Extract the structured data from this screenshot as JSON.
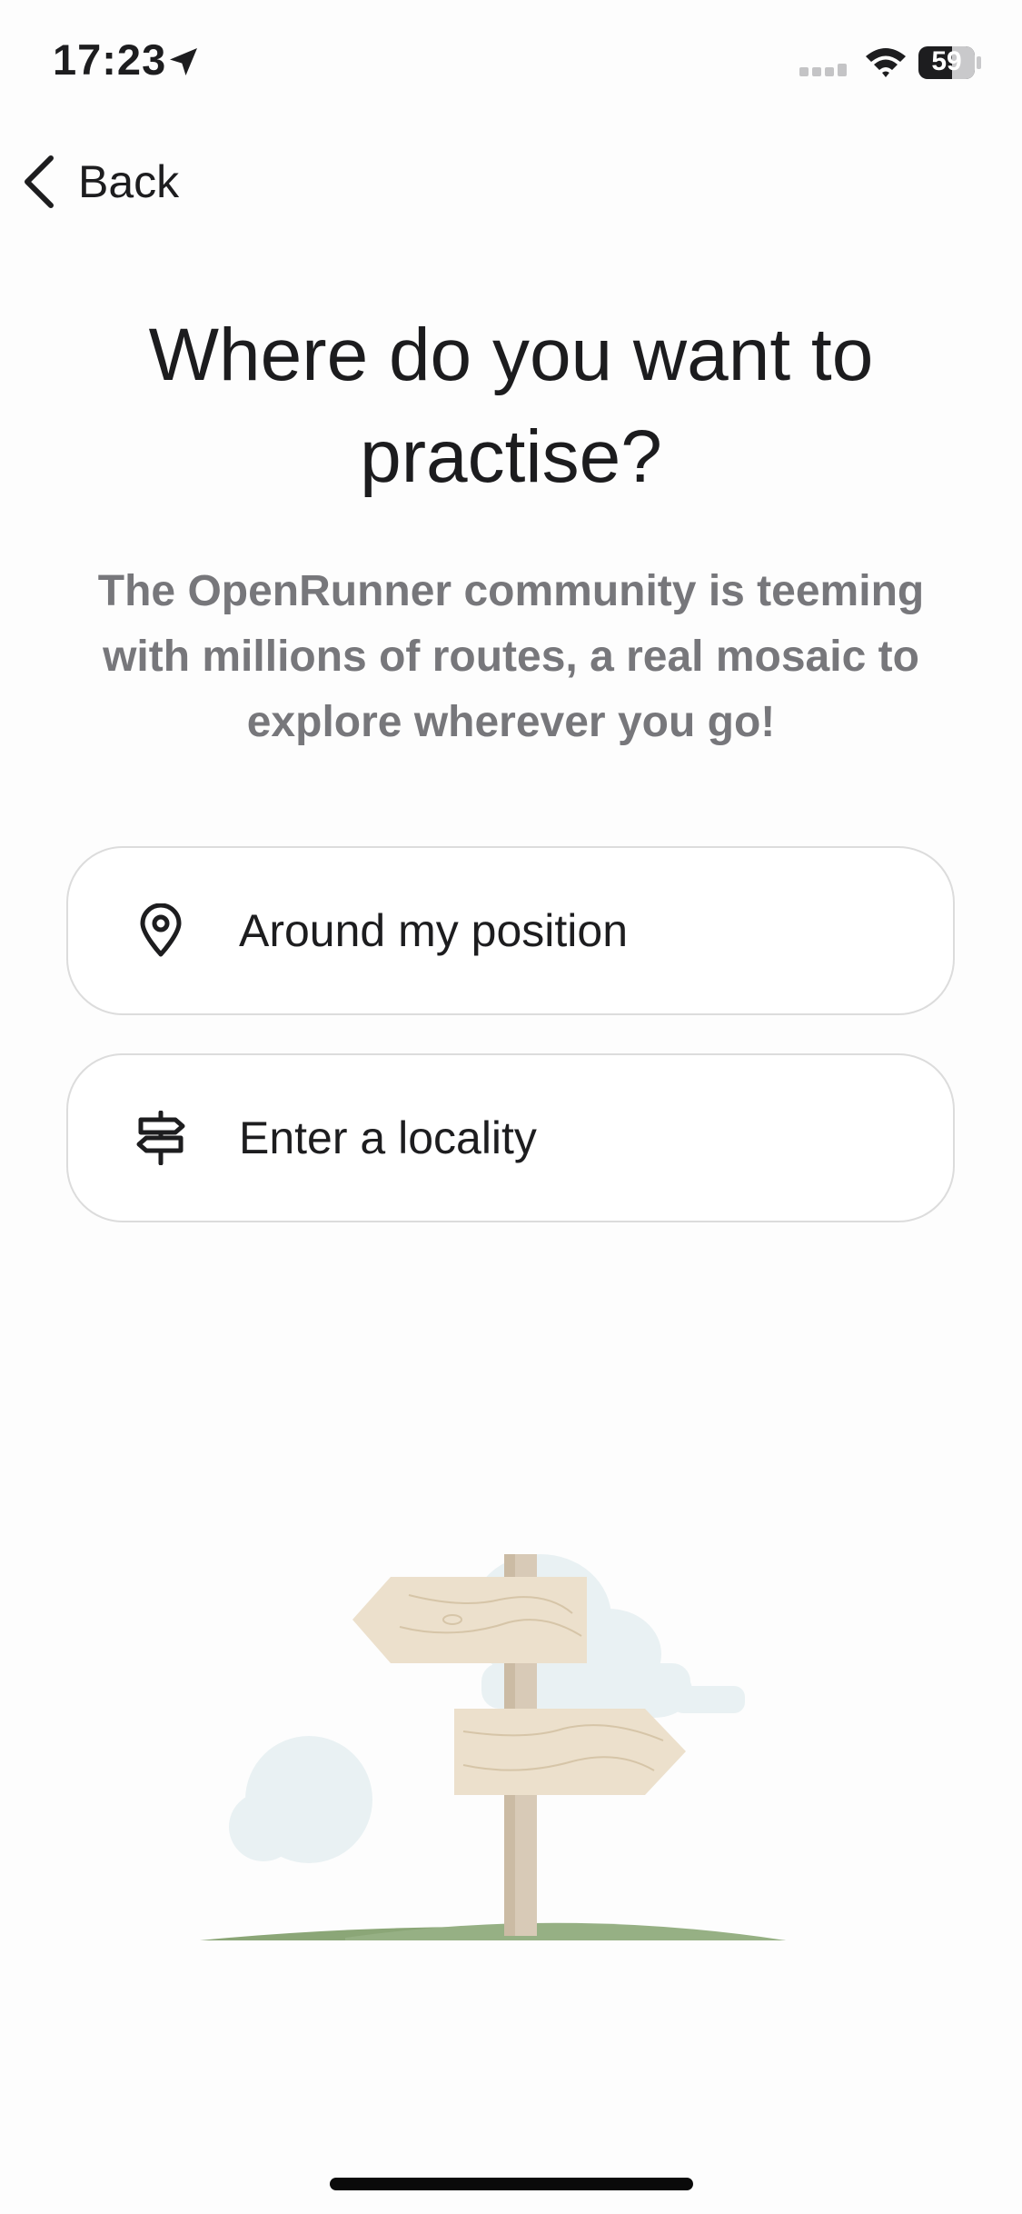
{
  "status_bar": {
    "time": "17:23",
    "battery": "59",
    "icons": [
      "location-arrow-icon",
      "signal-icon",
      "wifi-icon",
      "battery-icon"
    ]
  },
  "nav": {
    "back_label": "Back",
    "back_icon": "chevron-left-icon"
  },
  "header": {
    "title": "Where do you want to practise?",
    "subtitle": "The OpenRunner community is teeming with millions of routes, a real mosaic to explore wherever you go!"
  },
  "options": [
    {
      "label": "Around my position",
      "icon": "map-pin-icon"
    },
    {
      "label": "Enter a locality",
      "icon": "signpost-icon"
    }
  ],
  "illustration": {
    "icon": "signpost-illustration"
  },
  "colors": {
    "background": "#fdfdfd",
    "text_primary": "#1d1d1f",
    "text_secondary": "#77777b",
    "border": "#dcdcdc",
    "grass": "#8ba677",
    "wood": "#ece0cc",
    "cloud": "#e9f1f3"
  }
}
